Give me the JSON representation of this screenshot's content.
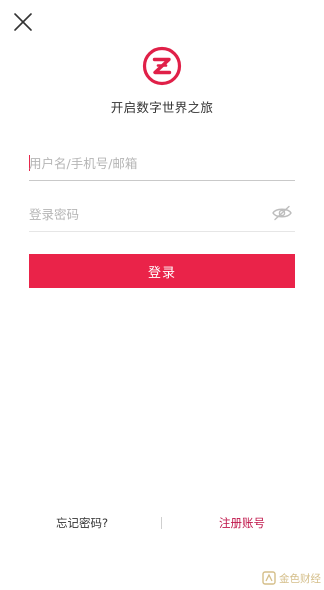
{
  "header": {
    "close_icon": "close-icon"
  },
  "brand": {
    "logo_icon": "zb-logo-icon",
    "slogan": "开启数字世界之旅",
    "accent_color": "#ea2349"
  },
  "form": {
    "username": {
      "placeholder": "用户名/手机号/邮箱",
      "value": ""
    },
    "password": {
      "placeholder": "登录密码",
      "value": "",
      "toggle_icon": "eye-hidden-icon"
    },
    "login_label": "登录"
  },
  "footer": {
    "forgot_label": "忘记密码?",
    "register_label": "注册账号"
  },
  "watermark": {
    "text": "金色财经"
  }
}
